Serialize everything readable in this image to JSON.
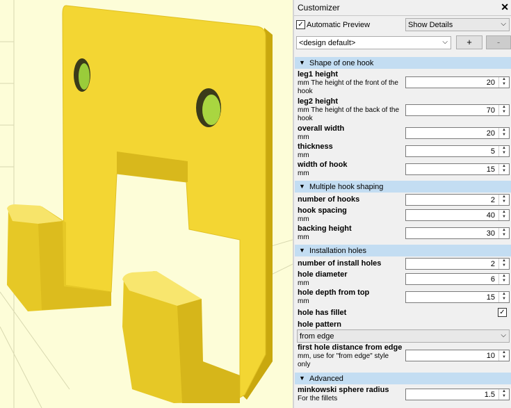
{
  "customizer": {
    "title": "Customizer",
    "close": "✕",
    "auto_preview_checked": "✓",
    "auto_preview_label": "Automatic Preview",
    "details_select": "Show Details",
    "preset": "<design default>",
    "add_btn": "+",
    "remove_btn": "-"
  },
  "groups": {
    "shape": {
      "title": "Shape of one hook",
      "leg1": {
        "label": "leg1 height",
        "desc": "mm The height of the front of the hook",
        "value": "20"
      },
      "leg2": {
        "label": "leg2 height",
        "desc": "mm The height of the back of the hook",
        "value": "70"
      },
      "width": {
        "label": "overall width",
        "desc": "mm",
        "value": "20"
      },
      "thickness": {
        "label": "thickness",
        "desc": "mm",
        "value": "5"
      },
      "hookwidth": {
        "label": "width of hook",
        "desc": "mm",
        "value": "15"
      }
    },
    "multiple": {
      "title": "Multiple hook shaping",
      "count": {
        "label": "number of hooks",
        "value": "2"
      },
      "spacing": {
        "label": "hook spacing",
        "desc": "mm",
        "value": "40"
      },
      "backing": {
        "label": "backing height",
        "desc": "mm",
        "value": "30"
      }
    },
    "install": {
      "title": "Installation holes",
      "holes": {
        "label": "number of install holes",
        "value": "2"
      },
      "diameter": {
        "label": "hole diameter",
        "desc": "mm",
        "value": "6"
      },
      "depth": {
        "label": "hole depth from top",
        "desc": "mm",
        "value": "15"
      },
      "fillet": {
        "label": "hole has fillet",
        "checked": "✓"
      },
      "pattern": {
        "label": "hole pattern",
        "value": "from edge"
      },
      "first": {
        "label": "first hole distance from edge",
        "desc": "mm, use for \"from edge\" style only",
        "value": "10"
      }
    },
    "advanced": {
      "title": "Advanced",
      "minkowski": {
        "label": "minkowski sphere radius",
        "desc": "For the fillets",
        "value": "1.5"
      }
    }
  },
  "colors": {
    "model": "#f2d433",
    "model_dark": "#d8b81c",
    "hole": "#9acc3a",
    "background": "#fdfdd8",
    "group_header": "#c3ddf2"
  }
}
